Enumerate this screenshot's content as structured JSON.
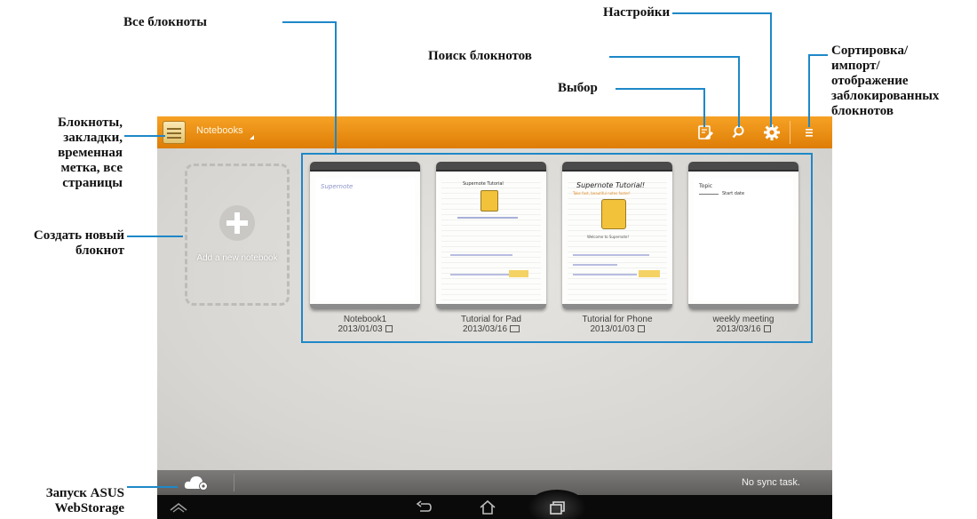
{
  "callouts": {
    "all_notebooks": "Все блокноты",
    "settings": "Настройки",
    "search_notebooks": "Поиск блокнотов",
    "select": "Выбор",
    "sort_import": "Сортировка/\nимпорт/\nотображение\nзаблокированных\nблокнотов",
    "notebooks_menu": "Блокноты,\nзакладки,\nвременная\nметка, все\nстраницы",
    "create_notebook": "Создать новый\nблокнот",
    "launch_webstorage": "Запуск ASUS\nWebStorage"
  },
  "app": {
    "title": "Notebooks",
    "accent": "#ef8d12",
    "add_notebook_label": "Add a new notebook",
    "sync_status": "No sync task.",
    "highlight_color": "#1e88c8"
  },
  "toolbar_icons": [
    "select-icon",
    "search-icon",
    "gear-icon",
    "menu-icon"
  ],
  "notebooks": [
    {
      "name": "Notebook1",
      "date": "2013/01/03"
    },
    {
      "name": "Tutorial for Pad",
      "date": "2013/03/16"
    },
    {
      "name": "Tutorial for Phone",
      "date": "2013/01/03"
    },
    {
      "name": "weekly meeting",
      "date": "2013/03/16"
    }
  ],
  "notebook_previews": {
    "nb1_scribble": "Supernote",
    "nb2_heading": "Supernote Tutorial",
    "nb3_heading": "Supernote Tutorial!",
    "nb3_subheading": "Take fast, beautiful notes faster!",
    "nb3_line1": "Welcome to Supernote!",
    "nb4_topic": "Topic",
    "nb4_start": "Start date"
  }
}
